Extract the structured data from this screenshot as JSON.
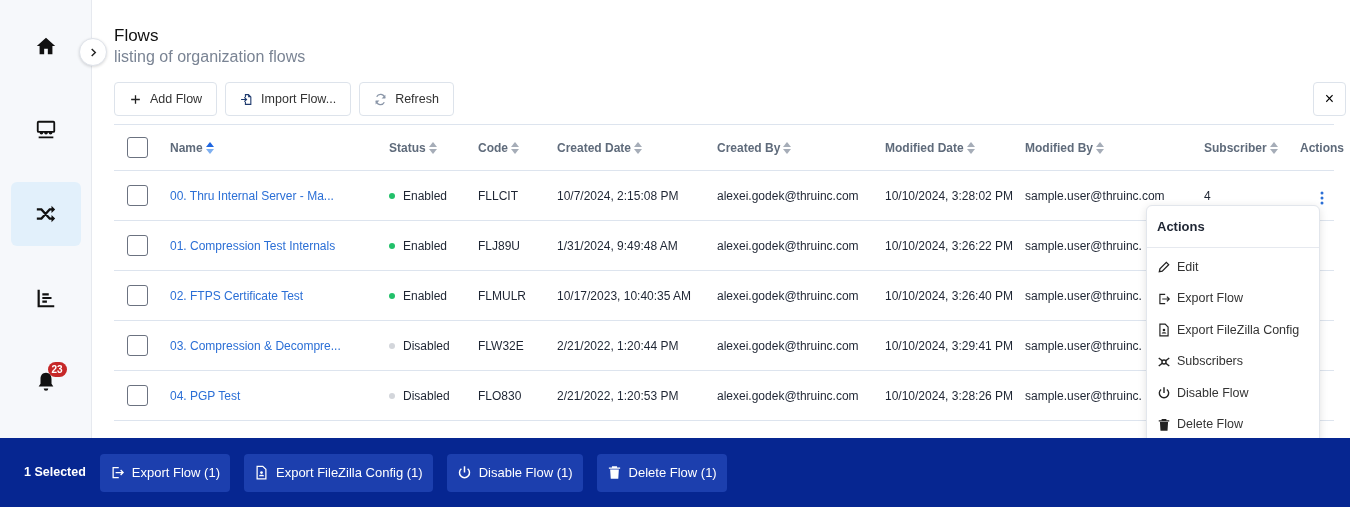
{
  "sidebar": {
    "items": [
      {
        "selected": false
      },
      {
        "selected": false
      },
      {
        "selected": true
      },
      {
        "selected": false
      },
      {
        "selected": false,
        "badge": "23"
      }
    ]
  },
  "page": {
    "title": "Flows",
    "subtitle": "listing of organization flows"
  },
  "toolbar": [
    {
      "label": "Add Flow"
    },
    {
      "label": "Import Flow..."
    },
    {
      "label": "Refresh"
    }
  ],
  "close_button": "×",
  "table": {
    "columns": [
      {
        "label": "Name",
        "sorted": true
      },
      {
        "label": "Status",
        "sorted": false
      },
      {
        "label": "Code",
        "sorted": false
      },
      {
        "label": "Created Date",
        "sorted": false
      },
      {
        "label": "Created By",
        "sorted": false
      },
      {
        "label": "Modified Date",
        "sorted": false
      },
      {
        "label": "Modified By",
        "sorted": false
      },
      {
        "label": "Subscriber",
        "sorted": false
      },
      {
        "label": "Actions"
      }
    ],
    "select_all_checked": false,
    "rows": [
      {
        "checked": false,
        "name": "00. Thru Internal Server - Ma...",
        "enabled": true,
        "status": "Enabled",
        "code": "FLLCIT",
        "created_date": "10/7/2024, 2:15:08 PM",
        "created_by": "alexei.godek@thruinc.com",
        "modified_date": "10/10/2024, 3:28:02 PM",
        "modified_by": "sample.user@thruinc.com",
        "subscriber": "4",
        "menu_open": true
      },
      {
        "checked": false,
        "name": "01. Compression Test Internals",
        "enabled": true,
        "status": "Enabled",
        "code": "FLJ89U",
        "created_date": "1/31/2024, 9:49:48 AM",
        "created_by": "alexei.godek@thruinc.com",
        "modified_date": "10/10/2024, 3:26:22 PM",
        "modified_by": "sample.user@thruinc.",
        "menu_open": false
      },
      {
        "checked": false,
        "name": "02. FTPS Certificate Test",
        "enabled": true,
        "status": "Enabled",
        "code": "FLMULR",
        "created_date": "10/17/2023, 10:40:35 AM",
        "created_by": "alexei.godek@thruinc.com",
        "modified_date": "10/10/2024, 3:26:40 PM",
        "modified_by": "sample.user@thruinc.",
        "menu_open": false
      },
      {
        "checked": false,
        "name": "03. Compression & Decompre...",
        "enabled": false,
        "status": "Disabled",
        "code": "FLW32E",
        "created_date": "2/21/2022, 1:20:44 PM",
        "created_by": "alexei.godek@thruinc.com",
        "modified_date": "10/10/2024, 3:29:41 PM",
        "modified_by": "sample.user@thruinc.",
        "menu_open": false
      },
      {
        "checked": false,
        "name": "04. PGP Test",
        "enabled": false,
        "status": "Disabled",
        "code": "FLO830",
        "created_date": "2/21/2022, 1:20:53 PM",
        "created_by": "alexei.godek@thruinc.com",
        "modified_date": "10/10/2024, 3:28:26 PM",
        "modified_by": "sample.user@thruinc.",
        "menu_open": false
      }
    ]
  },
  "actions_menu": {
    "title": "Actions",
    "items": [
      {
        "label": "Edit"
      },
      {
        "label": "Export Flow"
      },
      {
        "label": "Export FileZilla Config"
      },
      {
        "label": "Subscribers"
      },
      {
        "label": "Disable Flow"
      },
      {
        "label": "Delete Flow"
      }
    ]
  },
  "selection_bar": {
    "count_label": "1 Selected",
    "buttons": [
      {
        "label": "Export Flow (1)"
      },
      {
        "label": "Export FileZilla Config (1)"
      },
      {
        "label": "Disable Flow (1)"
      },
      {
        "label": "Delete Flow (1)"
      }
    ]
  }
}
